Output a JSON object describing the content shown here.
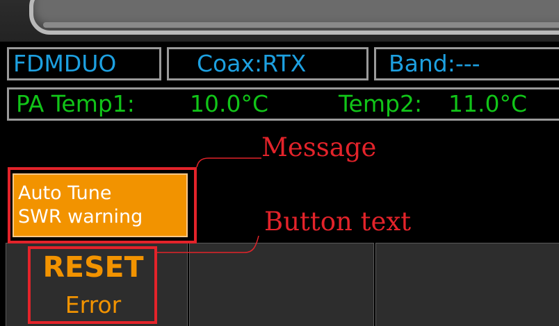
{
  "header": {
    "radio_label": "FDMDUO",
    "coax_label": "Coax:RTX",
    "band_label": "Band:---"
  },
  "temperatures": {
    "temp1_label": "PA Temp1:",
    "temp1_value": "10.0°C",
    "temp2_label": "Temp2:",
    "temp2_value": "11.0°C"
  },
  "message": {
    "line1": "Auto Tune",
    "line2": "SWR warning"
  },
  "softkey": {
    "title": "RESET",
    "subtitle": "Error"
  },
  "annotations": {
    "message_label": "Message",
    "button_label": "Button text"
  },
  "colors": {
    "header_text": "#1da0e0",
    "temperature_text": "#11c418",
    "message_background": "#f29300",
    "softkey_text": "#f29300",
    "annotation": "#e3232a",
    "screen_background": "#000000"
  }
}
